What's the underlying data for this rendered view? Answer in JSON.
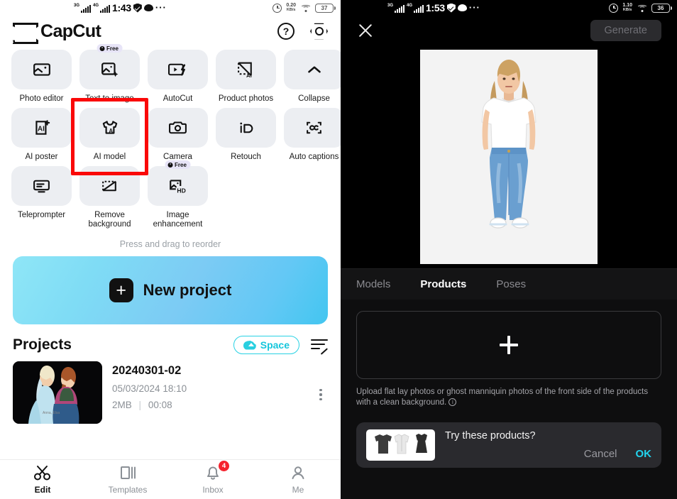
{
  "left": {
    "status_bar": {
      "net1": "3G",
      "net2": "4G",
      "time": "1:43",
      "icons": [
        "shield-icon",
        "chat-bubble-icon",
        "more-dots-icon"
      ],
      "speed_value": "0.20",
      "speed_unit": "KB/s",
      "battery": "37"
    },
    "app": {
      "name": "CapCut",
      "help_icon": "question-circle-icon",
      "settings_icon": "gear-icon"
    },
    "tools": [
      [
        {
          "label": "Photo editor",
          "icon": "photo-editor-icon",
          "badge": ""
        },
        {
          "label": "Text to image",
          "icon": "text-to-image-icon",
          "badge": "Free"
        },
        {
          "label": "AutoCut",
          "icon": "autocut-icon",
          "badge": ""
        },
        {
          "label": "Product photos",
          "icon": "product-photos-icon",
          "badge": ""
        },
        {
          "label": "Collapse",
          "icon": "chevron-up-icon",
          "badge": ""
        }
      ],
      [
        {
          "label": "AI poster",
          "icon": "ai-poster-icon",
          "badge": ""
        },
        {
          "label": "AI model",
          "icon": "ai-model-icon",
          "badge": "",
          "selected": true
        },
        {
          "label": "Camera",
          "icon": "camera-icon",
          "badge": ""
        },
        {
          "label": "Retouch",
          "icon": "retouch-icon",
          "badge": ""
        },
        {
          "label": "Auto captions",
          "icon": "auto-captions-icon",
          "badge": ""
        }
      ],
      [
        {
          "label": "Teleprompter",
          "icon": "teleprompter-icon",
          "badge": ""
        },
        {
          "label": "Remove background",
          "icon": "remove-background-icon",
          "badge": ""
        },
        {
          "label": "Image enhancement",
          "icon": "image-enhancement-icon",
          "badge": "Free"
        }
      ]
    ],
    "reorder_hint": "Press and drag to reorder",
    "new_project": {
      "label": "New project",
      "plus": "+"
    },
    "projects": {
      "title": "Projects",
      "space_label": "Space",
      "space_icon": "cloud-upload-icon",
      "list_edit_icon": "list-edit-icon",
      "items": [
        {
          "name": "20240301-02",
          "date": "05/03/2024 18:10",
          "size": "2MB",
          "separator": "|",
          "duration": "00:08"
        }
      ]
    },
    "tabbar": [
      {
        "label": "Edit",
        "icon": "scissors-icon",
        "active": true,
        "badge": ""
      },
      {
        "label": "Templates",
        "icon": "templates-icon",
        "active": false,
        "badge": ""
      },
      {
        "label": "Inbox",
        "icon": "bell-icon",
        "active": false,
        "badge": "4"
      },
      {
        "label": "Me",
        "icon": "person-icon",
        "active": false,
        "badge": ""
      }
    ],
    "colors": {
      "accent_cyan": "#29d2e4",
      "selection_red": "#fa0808",
      "badge_red": "#f5222d"
    }
  },
  "right": {
    "status_bar": {
      "net1": "3G",
      "net2": "4G",
      "time": "1:53",
      "speed_value": "1.10",
      "speed_unit": "KB/s",
      "battery": "36"
    },
    "topbar": {
      "close_icon": "close-icon",
      "generate_label": "Generate"
    },
    "preview": {
      "alt": "female-model-white-tshirt-blue-jeans"
    },
    "tabs": [
      {
        "label": "Models",
        "active": false
      },
      {
        "label": "Products",
        "active": true
      },
      {
        "label": "Poses",
        "active": false
      }
    ],
    "upload": {
      "plus_icon": "plus-icon",
      "hint": "Upload flat lay photos or ghost manniquin photos of the front side of the products with a clean background.",
      "info_icon": "info-icon"
    },
    "suggestion": {
      "title": "Try these products?",
      "thumb_alt": "three-garment-thumbnails",
      "cancel_label": "Cancel",
      "ok_label": "OK"
    },
    "colors": {
      "accent_cyan": "#22d3ee",
      "panel_bg": "#0e0e0f",
      "card_bg": "#2a2a2e"
    }
  }
}
